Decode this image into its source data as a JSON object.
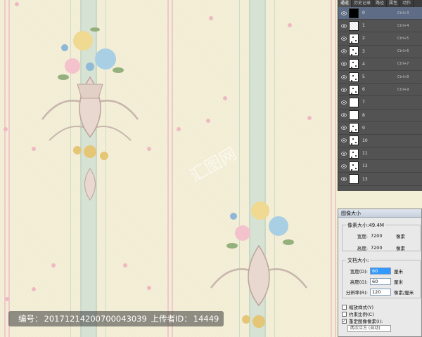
{
  "watermark": {
    "id_label": "编号：",
    "id_value": "20171214200700043039",
    "uploader_label": "上传者ID：",
    "uploader_value": "14449"
  },
  "layers_panel": {
    "tabs": [
      "通道",
      "历史记录",
      "路径",
      "属性",
      "动作"
    ],
    "layers": [
      {
        "name": "0",
        "shortcut": "Ctrl+3",
        "thumb": "black",
        "selected": true
      },
      {
        "name": "1",
        "shortcut": "Ctrl+4",
        "thumb": "noise"
      },
      {
        "name": "2",
        "shortcut": "Ctrl+5",
        "thumb": "dots"
      },
      {
        "name": "3",
        "shortcut": "Ctrl+6",
        "thumb": "dots"
      },
      {
        "name": "4",
        "shortcut": "Ctrl+7",
        "thumb": "dots"
      },
      {
        "name": "5",
        "shortcut": "Ctrl+8",
        "thumb": "dots"
      },
      {
        "name": "6",
        "shortcut": "Ctrl+9",
        "thumb": "dots"
      },
      {
        "name": "7",
        "shortcut": "",
        "thumb": "plain"
      },
      {
        "name": "8",
        "shortcut": "",
        "thumb": "plain"
      },
      {
        "name": "9",
        "shortcut": "",
        "thumb": "dots"
      },
      {
        "name": "10",
        "shortcut": "",
        "thumb": "dots"
      },
      {
        "name": "11",
        "shortcut": "",
        "thumb": "dots"
      },
      {
        "name": "12",
        "shortcut": "",
        "thumb": "dots"
      },
      {
        "name": "13",
        "shortcut": "",
        "thumb": "plain"
      }
    ]
  },
  "dialog": {
    "title": "图像大小",
    "pixel_size_label": "像素大小:49.4M",
    "width_label": "宽度:",
    "width_value": "7200",
    "width_unit": "像素",
    "height_label": "高度:",
    "height_value": "7200",
    "height_unit": "像素",
    "doc_size_label": "文档大小:",
    "doc_width_label": "宽度(D):",
    "doc_width_value": "60",
    "doc_width_unit": "厘米",
    "doc_height_label": "高度(G):",
    "doc_height_value": "60",
    "doc_height_unit": "厘米",
    "resolution_label": "分辨率(R):",
    "resolution_value": "120",
    "resolution_unit": "像素/厘米",
    "scale_styles": "缩放样式(Y)",
    "constrain": "约束比例(C)",
    "resample": "重定图像像素(I):",
    "resample_method": "两次立方 (自动)"
  },
  "colors": {
    "wallpaper_bg": "#f4efd8",
    "stripe_green": "#d6e2d4",
    "stripe_pink": "#efc9c9",
    "panel_bg": "#535353",
    "selected_row": "#5e6d85"
  }
}
